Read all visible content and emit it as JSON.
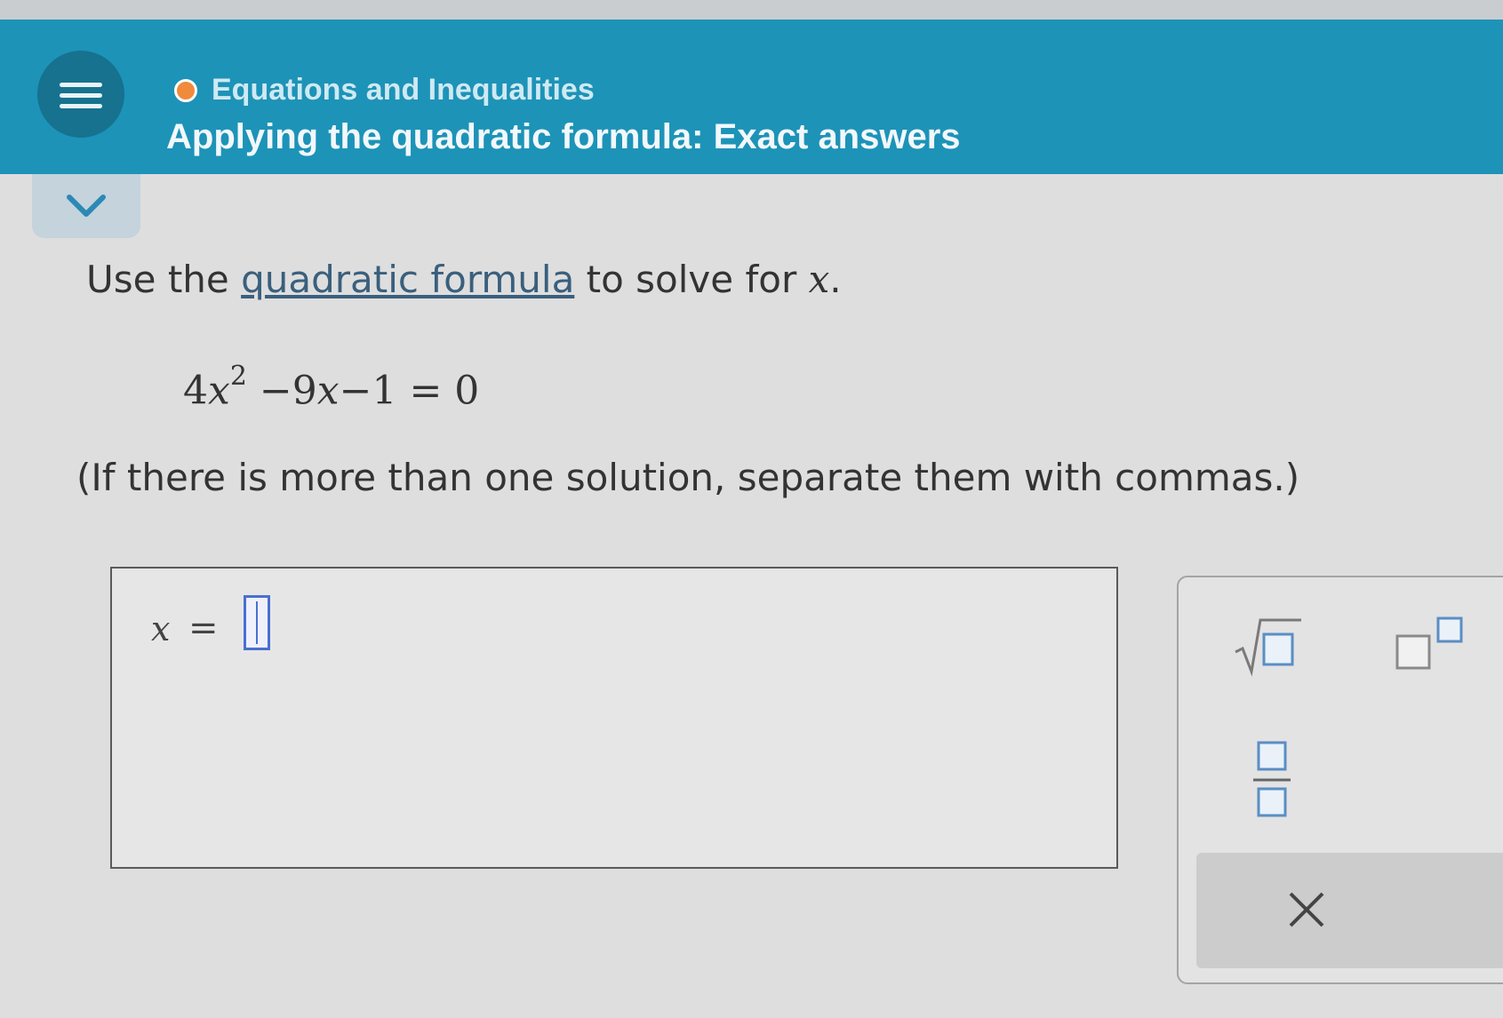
{
  "header": {
    "topic": "Equations and Inequalities",
    "lesson_title": "Applying the quadratic formula: Exact answers",
    "menu_icon": "hamburger-menu-icon",
    "topic_status_color": "#f08a3c",
    "bar_color": "#1d93b8"
  },
  "collapse_tab": {
    "icon": "chevron-down-icon"
  },
  "question": {
    "prompt_before": "Use the ",
    "prompt_link": "quadratic formula",
    "prompt_after": " to solve for ",
    "prompt_var": "x",
    "prompt_end": ".",
    "equation": {
      "coef": "4",
      "var": "x",
      "exponent": "2",
      "rest_coef": " −9",
      "rest_var": "x",
      "rest_tail": "−1 = 0"
    },
    "note": "(If there is more than one solution, separate them with commas.)"
  },
  "answer": {
    "variable": "x",
    "equals": "=",
    "value": ""
  },
  "keypad": {
    "buttons": [
      "square-root",
      "exponent",
      "fraction",
      "clear"
    ],
    "clear_icon": "close-icon"
  }
}
